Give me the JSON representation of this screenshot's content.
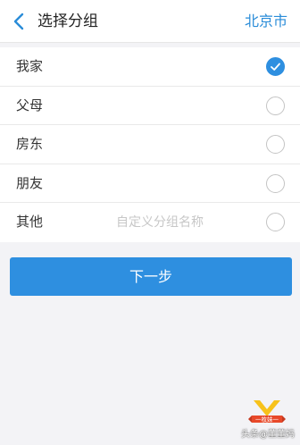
{
  "header": {
    "title": "选择分组",
    "city": "北京市"
  },
  "groups": [
    {
      "label": "我家",
      "checked": true
    },
    {
      "label": "父母",
      "checked": false
    },
    {
      "label": "房东",
      "checked": false
    },
    {
      "label": "朋友",
      "checked": false
    },
    {
      "label": "其他",
      "checked": false,
      "placeholder": "自定义分组名称"
    }
  ],
  "next_button": "下一步",
  "watermark": {
    "badge_text": "一枚妹一",
    "source": "头条@董董妈"
  },
  "colors": {
    "accent": "#2e8fe0",
    "city_link": "#2a8cd8",
    "page_bg": "#f3f3f6"
  }
}
